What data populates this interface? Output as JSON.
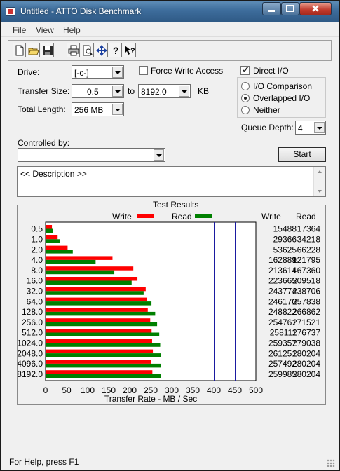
{
  "window": {
    "title": "Untitled - ATTO Disk Benchmark"
  },
  "menu": {
    "file": "File",
    "view": "View",
    "help": "Help"
  },
  "toolbar": {
    "icons": [
      "new-icon",
      "open-icon",
      "save-icon",
      "print-icon",
      "print-preview-icon",
      "move-icon",
      "help-icon",
      "context-help-icon"
    ]
  },
  "settings": {
    "drive_label": "Drive:",
    "drive_value": "[-c-]",
    "force_write_access_label": "Force Write Access",
    "force_write_access_checked": false,
    "transfer_size_label": "Transfer Size:",
    "transfer_from": "0.5",
    "to_label": "to",
    "transfer_to": "8192.0",
    "unit": "KB",
    "total_length_label": "Total Length:",
    "total_length_value": "256 MB",
    "direct_io_label": "Direct I/O",
    "direct_io_checked": true,
    "io_comparison_label": "I/O Comparison",
    "overlapped_io_label": "Overlapped I/O",
    "neither_label": "Neither",
    "selected_mode": "Overlapped I/O",
    "queue_depth_label": "Queue Depth:",
    "queue_depth_value": "4",
    "controlled_by_label": "Controlled by:",
    "controlled_by_value": ""
  },
  "start_label": "Start",
  "description": "<< Description >>",
  "status": "For Help, press F1",
  "colors": {
    "write": "#ff0000",
    "read": "#008000"
  },
  "chart_data": {
    "type": "bar",
    "title": "Test Results",
    "orientation": "horizontal",
    "categories": [
      "0.5",
      "1.0",
      "2.0",
      "4.0",
      "8.0",
      "16.0",
      "32.0",
      "64.0",
      "128.0",
      "256.0",
      "512.0",
      "1024.0",
      "2048.0",
      "4096.0",
      "8192.0"
    ],
    "series": [
      {
        "name": "Write",
        "values": [
          15488,
          29366,
          53625,
          162889,
          213614,
          223665,
          243774,
          246170,
          248822,
          254761,
          258111,
          259357,
          261251,
          257492,
          259985
        ]
      },
      {
        "name": "Read",
        "values": [
          17364,
          34218,
          66228,
          121795,
          167360,
          209518,
          238706,
          257838,
          266862,
          271521,
          276737,
          279038,
          280204,
          280204,
          280204
        ]
      }
    ],
    "table_headers": [
      "Write",
      "Read"
    ],
    "xlabel": "Transfer Rate - MB / Sec",
    "xticks": [
      0,
      50,
      100,
      150,
      200,
      250,
      300,
      350,
      400,
      450,
      500
    ],
    "xlim": [
      0,
      500
    ],
    "grid": true,
    "legend_position": "top"
  }
}
